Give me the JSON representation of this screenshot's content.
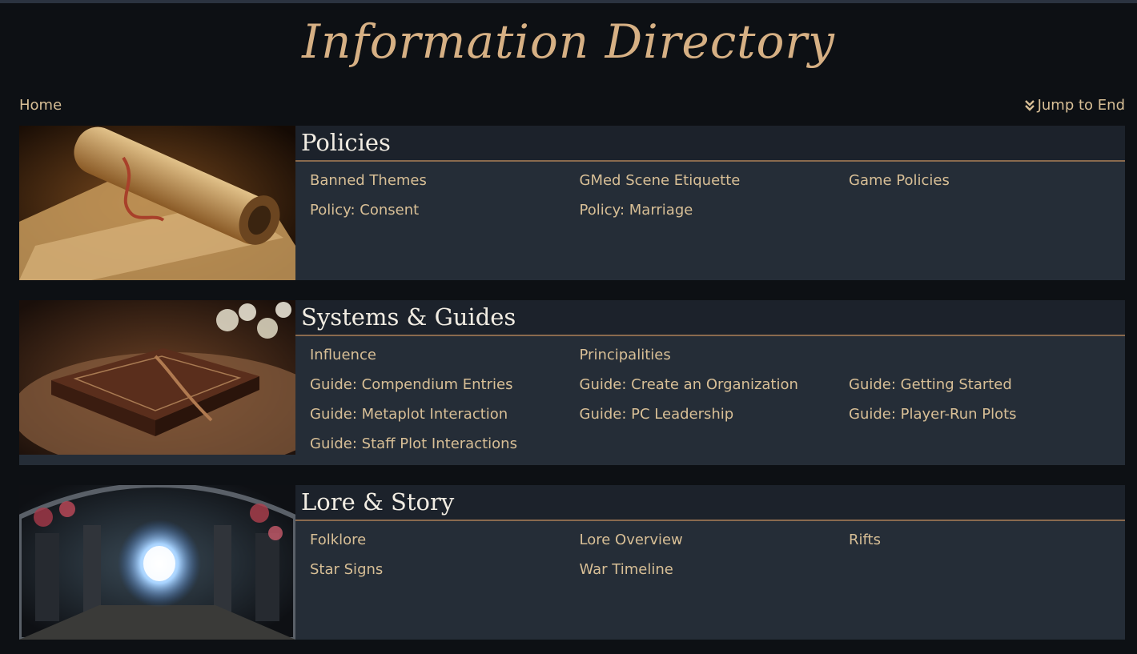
{
  "header": {
    "title": "Information Directory",
    "home_label": "Home",
    "jump_label": "Jump to End"
  },
  "colors": {
    "background": "#0d1014",
    "panel": "#252d37",
    "heading_bar": "#1c222b",
    "accent_gold": "#d6b084",
    "link": "#d8bf96",
    "divider": "#8a6a4e"
  },
  "sections": [
    {
      "heading": "Policies",
      "image": "rolled-scroll-image",
      "links": [
        "Banned Themes",
        "GMed Scene Etiquette",
        "Game Policies",
        "Policy: Consent",
        "Policy: Marriage"
      ]
    },
    {
      "heading": "Systems & Guides",
      "image": "leather-book-image",
      "links": [
        "Influence",
        "Principalities",
        "",
        "Guide: Compendium Entries",
        "Guide: Create an Organization",
        "Guide: Getting Started",
        "Guide: Metaplot Interaction",
        "Guide: PC Leadership",
        "Guide: Player-Run Plots",
        "Guide: Staff Plot Interactions"
      ]
    },
    {
      "heading": "Lore & Story",
      "image": "glowing-portal-image",
      "links": [
        "Folklore",
        "Lore Overview",
        "Rifts",
        "Star Signs",
        "War Timeline"
      ]
    }
  ]
}
